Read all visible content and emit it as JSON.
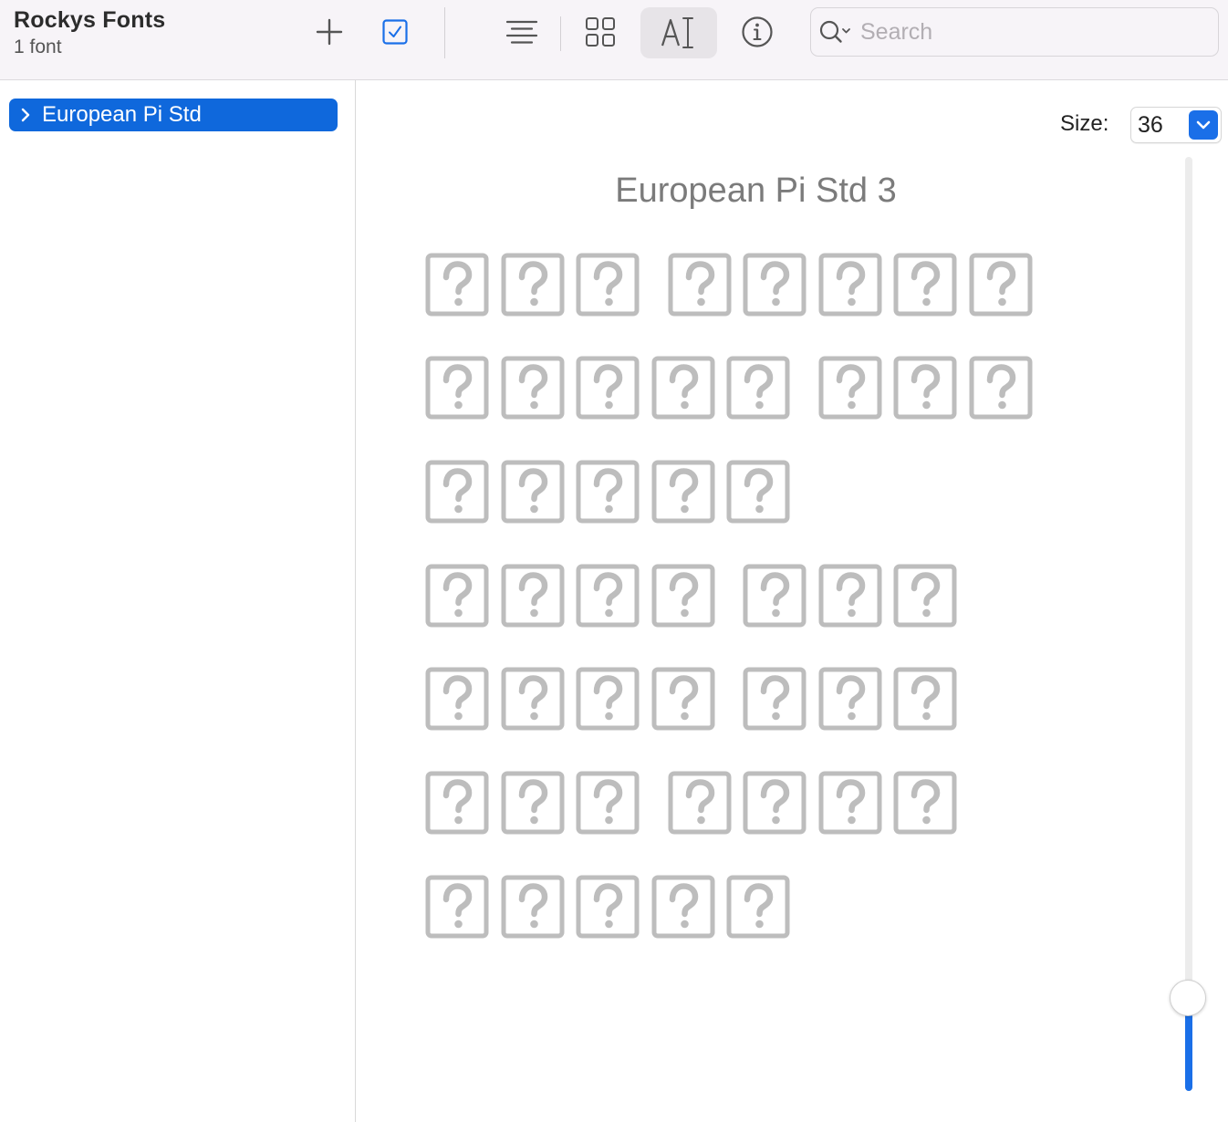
{
  "header": {
    "title": "Rockys Fonts",
    "subtitle": "1 font"
  },
  "toolbar": {
    "buttons": [
      {
        "name": "add",
        "icon": "plus-icon"
      },
      {
        "name": "enable",
        "icon": "checkbox-icon"
      },
      {
        "name": "view-sample",
        "icon": "text-lines-icon"
      },
      {
        "name": "view-grid",
        "icon": "grid-icon"
      },
      {
        "name": "view-custom",
        "icon": "text-cursor-icon",
        "active": true
      },
      {
        "name": "info",
        "icon": "info-icon"
      }
    ],
    "search": {
      "placeholder": "Search",
      "value": ""
    }
  },
  "sidebar": {
    "items": [
      {
        "label": "European Pi Std",
        "selected": true,
        "expanded": false
      }
    ]
  },
  "preview": {
    "size_label": "Size:",
    "size_value": "36",
    "title": "European Pi Std 3",
    "slider_fraction": 0.1,
    "rows": [
      [
        true,
        true,
        true,
        false,
        true,
        true,
        true,
        true,
        true
      ],
      [
        true,
        true,
        true,
        true,
        true,
        false,
        true,
        true,
        true
      ],
      [
        true,
        true,
        true,
        true,
        true
      ],
      [
        true,
        true,
        true,
        true,
        false,
        true,
        true,
        true
      ],
      [
        true,
        true,
        true,
        true,
        false,
        true,
        true,
        true
      ],
      [
        true,
        true,
        true,
        false,
        true,
        true,
        true,
        true
      ],
      [
        true,
        true,
        true,
        true,
        true
      ]
    ]
  },
  "colors": {
    "accent": "#0f68dc",
    "glyph": "#bdbdbd",
    "title": "#7b7b7b"
  }
}
